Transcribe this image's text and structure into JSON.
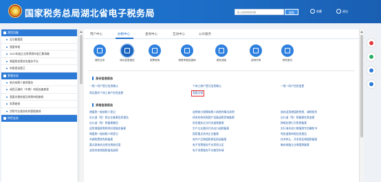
{
  "header": {
    "title": "国家税务总局湖北省电子税务局",
    "search_placeholder": "输入关键词搜索内容",
    "search_label": "搜索",
    "link_favorites": "收藏",
    "link_logout": "退出"
  },
  "sidebar": {
    "sections": [
      {
        "title": "常用功能",
        "items": [
          "全功能搜索",
          "我要申报",
          "2020年度企业所得税年度汇算清缴",
          "增值税发票综合服务平台",
          "申报错误更正"
        ]
      },
      {
        "title": "套餐业务",
        "items": [
          "新办纳税人套餐服务",
          "调用正确的（中期）申报加速套餐",
          "我要办理房屋及附属申报套餐",
          "发票套餐",
          "涉税专业服务机构管理套餐"
        ]
      },
      {
        "title": "特色业务",
        "items": []
      }
    ]
  },
  "tabs": [
    "用户中心",
    "办税中心",
    "查询中心",
    "互动中心",
    "公众服务"
  ],
  "functions": [
    "我的业务",
    "综合信息报告",
    "发票使用",
    "税费申报及缴纳",
    "税收减免",
    "证明开具",
    "税务登记"
  ],
  "sections": {
    "identity": {
      "title": "身份信息报告",
      "items": [
        "一照一码户登记信息确认",
        "个体工商户登记信息确认",
        "一照一码户信息变更",
        "两证整合个体工商户信息变更",
        "我要注销"
      ]
    },
    "qualification": {
      "title": "资格信息报告",
      "items": [
        "增值税一般纳税人登记",
        "选择按小规模纳税人纳税的情况说明",
        "放弃适用增值税免税、减税权利",
        "出口退（免）税企业备案信息报告",
        "研发机构采购国产设备退税资格备案",
        "出口退（免）税备案信息变更",
        "出口退（免）税备案撤回",
        "综合服务企业代办退税备案",
        "跨境应税行为免税备案",
        "适用增值税零税率应税服务备案",
        "生产企业委托代办出口退税备案",
        "实行海关进口增值税专用缴款书",
        "增值税一般纳税人转登记",
        "国家重点扶持企业备案",
        "免抵退税申报信息报告",
        "车辆购置税免税备案",
        "软件产品增值税即征即退备案",
        "技术转让、开发免征增值税备案",
        "重点群体创业就业税收优惠",
        "电子发票服务平台资质认定",
        "集成电路企业增值税备案",
        "选用其他增值税留抵退税",
        "电子发票服务平台使用申请"
      ]
    }
  }
}
